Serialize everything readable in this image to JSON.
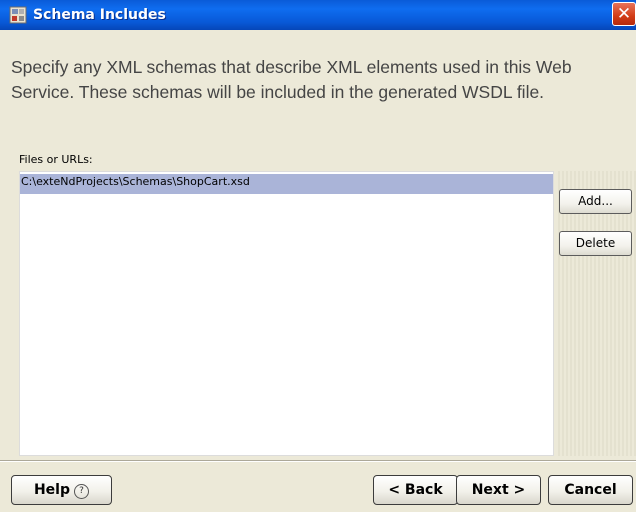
{
  "window": {
    "title": "Schema Includes",
    "close_symbol": "✕"
  },
  "instruction": "Specify any XML schemas that describe XML elements used in this Web Service.  These schemas will be included in the generated WSDL file.",
  "files": {
    "label": "Files or URLs:",
    "items": [
      "C:\\exteNdProjects\\Schemas\\ShopCart.xsd"
    ],
    "selected_index": 0
  },
  "side_buttons": {
    "add_label": "Add...",
    "delete_label": "Delete"
  },
  "footer": {
    "help_label": "Help",
    "help_icon_glyph": "?",
    "back_label": "< Back",
    "next_label": "Next >",
    "cancel_label": "Cancel"
  },
  "colors": {
    "titlebar": "#0a5bd8",
    "selection": "#aab4d8",
    "close": "#d23c16"
  }
}
